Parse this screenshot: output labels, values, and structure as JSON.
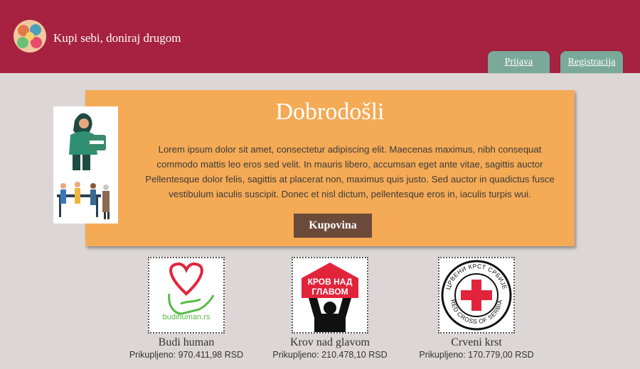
{
  "header": {
    "site_title": "Kupi sebi, doniraj drugom",
    "login_label": "Prijava",
    "register_label": "Registracija"
  },
  "welcome": {
    "title": "Dobrodošli",
    "text": "Lorem ipsum dolor sit amet, consectetur adipiscing elit. Maecenas maximus, nibh consequat commodo mattis leo eros sed velit. In mauris libero, accumsan eget ante vitae, sagittis auctor Pellentesque dolor felis, sagittis at placerat non, maximus quis justo. Sed auctor in quadictus fusce vestibulum iaculis suscipit. Donec et nisl dictum, pellentesque eros in, iaculis turpis wui.",
    "buy_label": "Kupovina"
  },
  "organizations": [
    {
      "name": "Budi human",
      "raised": "Prikupljeno: 970.411,98 RSD",
      "logo_text": "budihuman.rs"
    },
    {
      "name": "Krov nad glavom",
      "raised": "Prikupljeno: 210.478,10 RSD",
      "logo_text": [
        "КРОВ НАД",
        "ГЛАВОМ"
      ]
    },
    {
      "name": "Crveni krst",
      "raised": "Prikupljeno: 170.779,00 RSD",
      "logo_text": [
        "ЦРВЕНИ КРСТ СРБИЈЕ",
        "RED CROSS OF SERBIA"
      ]
    }
  ],
  "colors": {
    "header": "#a72240",
    "tab": "#7aa99a",
    "panel": "#f5aa55",
    "button": "#6b4a3a",
    "background": "#dcd7d6"
  }
}
